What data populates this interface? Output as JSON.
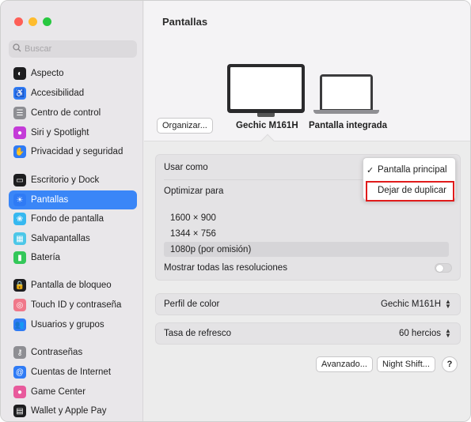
{
  "sidebar": {
    "search_placeholder": "Buscar",
    "items": [
      {
        "label": "Aspecto",
        "icon": "appearance-icon",
        "color": "#1d1d1f"
      },
      {
        "label": "Accesibilidad",
        "icon": "accessibility-icon",
        "color": "#2f7bf5"
      },
      {
        "label": "Centro de control",
        "icon": "control-center-icon",
        "color": "#8e8e93"
      },
      {
        "label": "Siri y Spotlight",
        "icon": "siri-icon",
        "color": "#c43bd8"
      },
      {
        "label": "Privacidad y seguridad",
        "icon": "privacy-hand-icon",
        "color": "#2f7bf5"
      },
      {
        "label": "Escritorio y Dock",
        "icon": "desktop-dock-icon",
        "color": "#1d1d1f"
      },
      {
        "label": "Pantallas",
        "icon": "displays-icon",
        "color": "#2f7bf5"
      },
      {
        "label": "Fondo de pantalla",
        "icon": "wallpaper-icon",
        "color": "#36b8f0"
      },
      {
        "label": "Salvapantallas",
        "icon": "screensaver-icon",
        "color": "#4cc7e8"
      },
      {
        "label": "Batería",
        "icon": "battery-icon",
        "color": "#33c759"
      },
      {
        "label": "Pantalla de bloqueo",
        "icon": "lock-screen-icon",
        "color": "#1d1d1f"
      },
      {
        "label": "Touch ID y contraseña",
        "icon": "fingerprint-icon",
        "color": "#f0788a"
      },
      {
        "label": "Usuarios y grupos",
        "icon": "users-icon",
        "color": "#2f7bf5"
      },
      {
        "label": "Contraseñas",
        "icon": "key-icon",
        "color": "#8e8e93"
      },
      {
        "label": "Cuentas de Internet",
        "icon": "at-sign-icon",
        "color": "#2f7bf5"
      },
      {
        "label": "Game Center",
        "icon": "game-center-icon",
        "color": "#e85a9c"
      },
      {
        "label": "Wallet y Apple Pay",
        "icon": "wallet-icon",
        "color": "#1d1d1f"
      }
    ],
    "active": "Pantallas"
  },
  "main": {
    "title": "Pantallas",
    "organize_button": "Organizar...",
    "displays": [
      "Gechic M161H",
      "Pantalla integrada"
    ],
    "rows": {
      "usar_como": "Usar como",
      "optimizar_para": "Optimizar para",
      "mostrar_resoluciones": "Mostrar todas las resoluciones",
      "perfil_color": "Perfil de color",
      "perfil_color_value": "Gechic M161H",
      "tasa_refresco": "Tasa de refresco",
      "tasa_refresco_value": "60 hercios"
    },
    "resolutions": [
      "1600 × 900",
      "1344 × 756",
      "1080p (por omisión)"
    ],
    "selected_resolution": "1080p (por omisión)",
    "show_all_resolutions_on": false,
    "menu": {
      "items": [
        "Pantalla principal",
        "Dejar de duplicar"
      ],
      "checked": "Pantalla principal",
      "highlighted": "Dejar de duplicar",
      "check_mark": "✓"
    },
    "buttons": {
      "advanced": "Avanzado...",
      "night_shift": "Night Shift...",
      "help": "?"
    }
  }
}
